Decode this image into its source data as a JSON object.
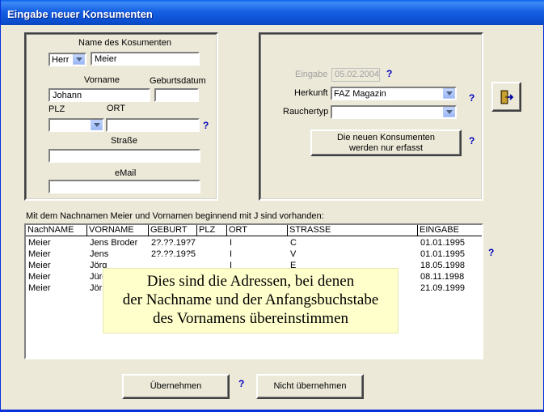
{
  "window": {
    "title": "Eingabe neuer Konsumenten"
  },
  "left_panel": {
    "name_label": "Name des Kosumenten",
    "anrede_value": "Herr",
    "nachname_value": "Meier",
    "vorname_label": "Vorname",
    "geburtsdatum_label": "Geburtsdatum",
    "vorname_value": "Johann",
    "geburtsdatum_value": "",
    "plz_label": "PLZ",
    "ort_label": "ORT",
    "plz_value": "",
    "ort_value": "",
    "strasse_label": "Straße",
    "strasse_value": "",
    "email_label": "eMail",
    "email_value": ""
  },
  "right_panel": {
    "eingabe_label": "Eingabe",
    "eingabe_value": "05.02.2004",
    "herkunft_label": "Herkunft",
    "herkunft_value": "FAZ Magazin",
    "rauchertyp_label": "Rauchertyp",
    "rauchertyp_value": "",
    "erfasst_button": "Die neuen Konsumenten werden nur erfasst"
  },
  "help_mark": "?",
  "list": {
    "caption": "Mit dem Nachnamen Meier und Vornamen beginnend mit J sind vorhanden:",
    "columns": [
      "NachNAME",
      "VORNAME",
      "GEBURT",
      "PLZ",
      "ORT",
      "STRASSE",
      "EINGABE"
    ],
    "rows": [
      [
        "Meier",
        "Jens Broder",
        "2?.??.19?7",
        "",
        "I",
        "C",
        "01.01.1995"
      ],
      [
        "Meier",
        "Jens",
        "2?.??.19?5",
        "",
        "I",
        "V",
        "01.01.1995"
      ],
      [
        "Meier",
        "Jörg",
        "",
        "",
        "I",
        "E",
        "18.05.1998"
      ],
      [
        "Meier",
        "Jürg",
        "",
        "",
        "",
        "",
        "08.11.1998"
      ],
      [
        "Meier",
        "Jörn",
        "",
        "",
        "",
        "",
        "21.09.1999"
      ]
    ]
  },
  "tooltip": {
    "line1": "Dies sind die Adressen, bei denen",
    "line2": "der Nachname und der Anfangsbuchstabe",
    "line3": "des Vornamens übereinstimmen"
  },
  "footer": {
    "uebernehmen_button": "Übernehmen",
    "nicht_uebernehmen_button": "Nicht übernehmen"
  },
  "icons": {
    "exit": "exit-door-icon",
    "dropdown": "chevron-down-icon"
  }
}
